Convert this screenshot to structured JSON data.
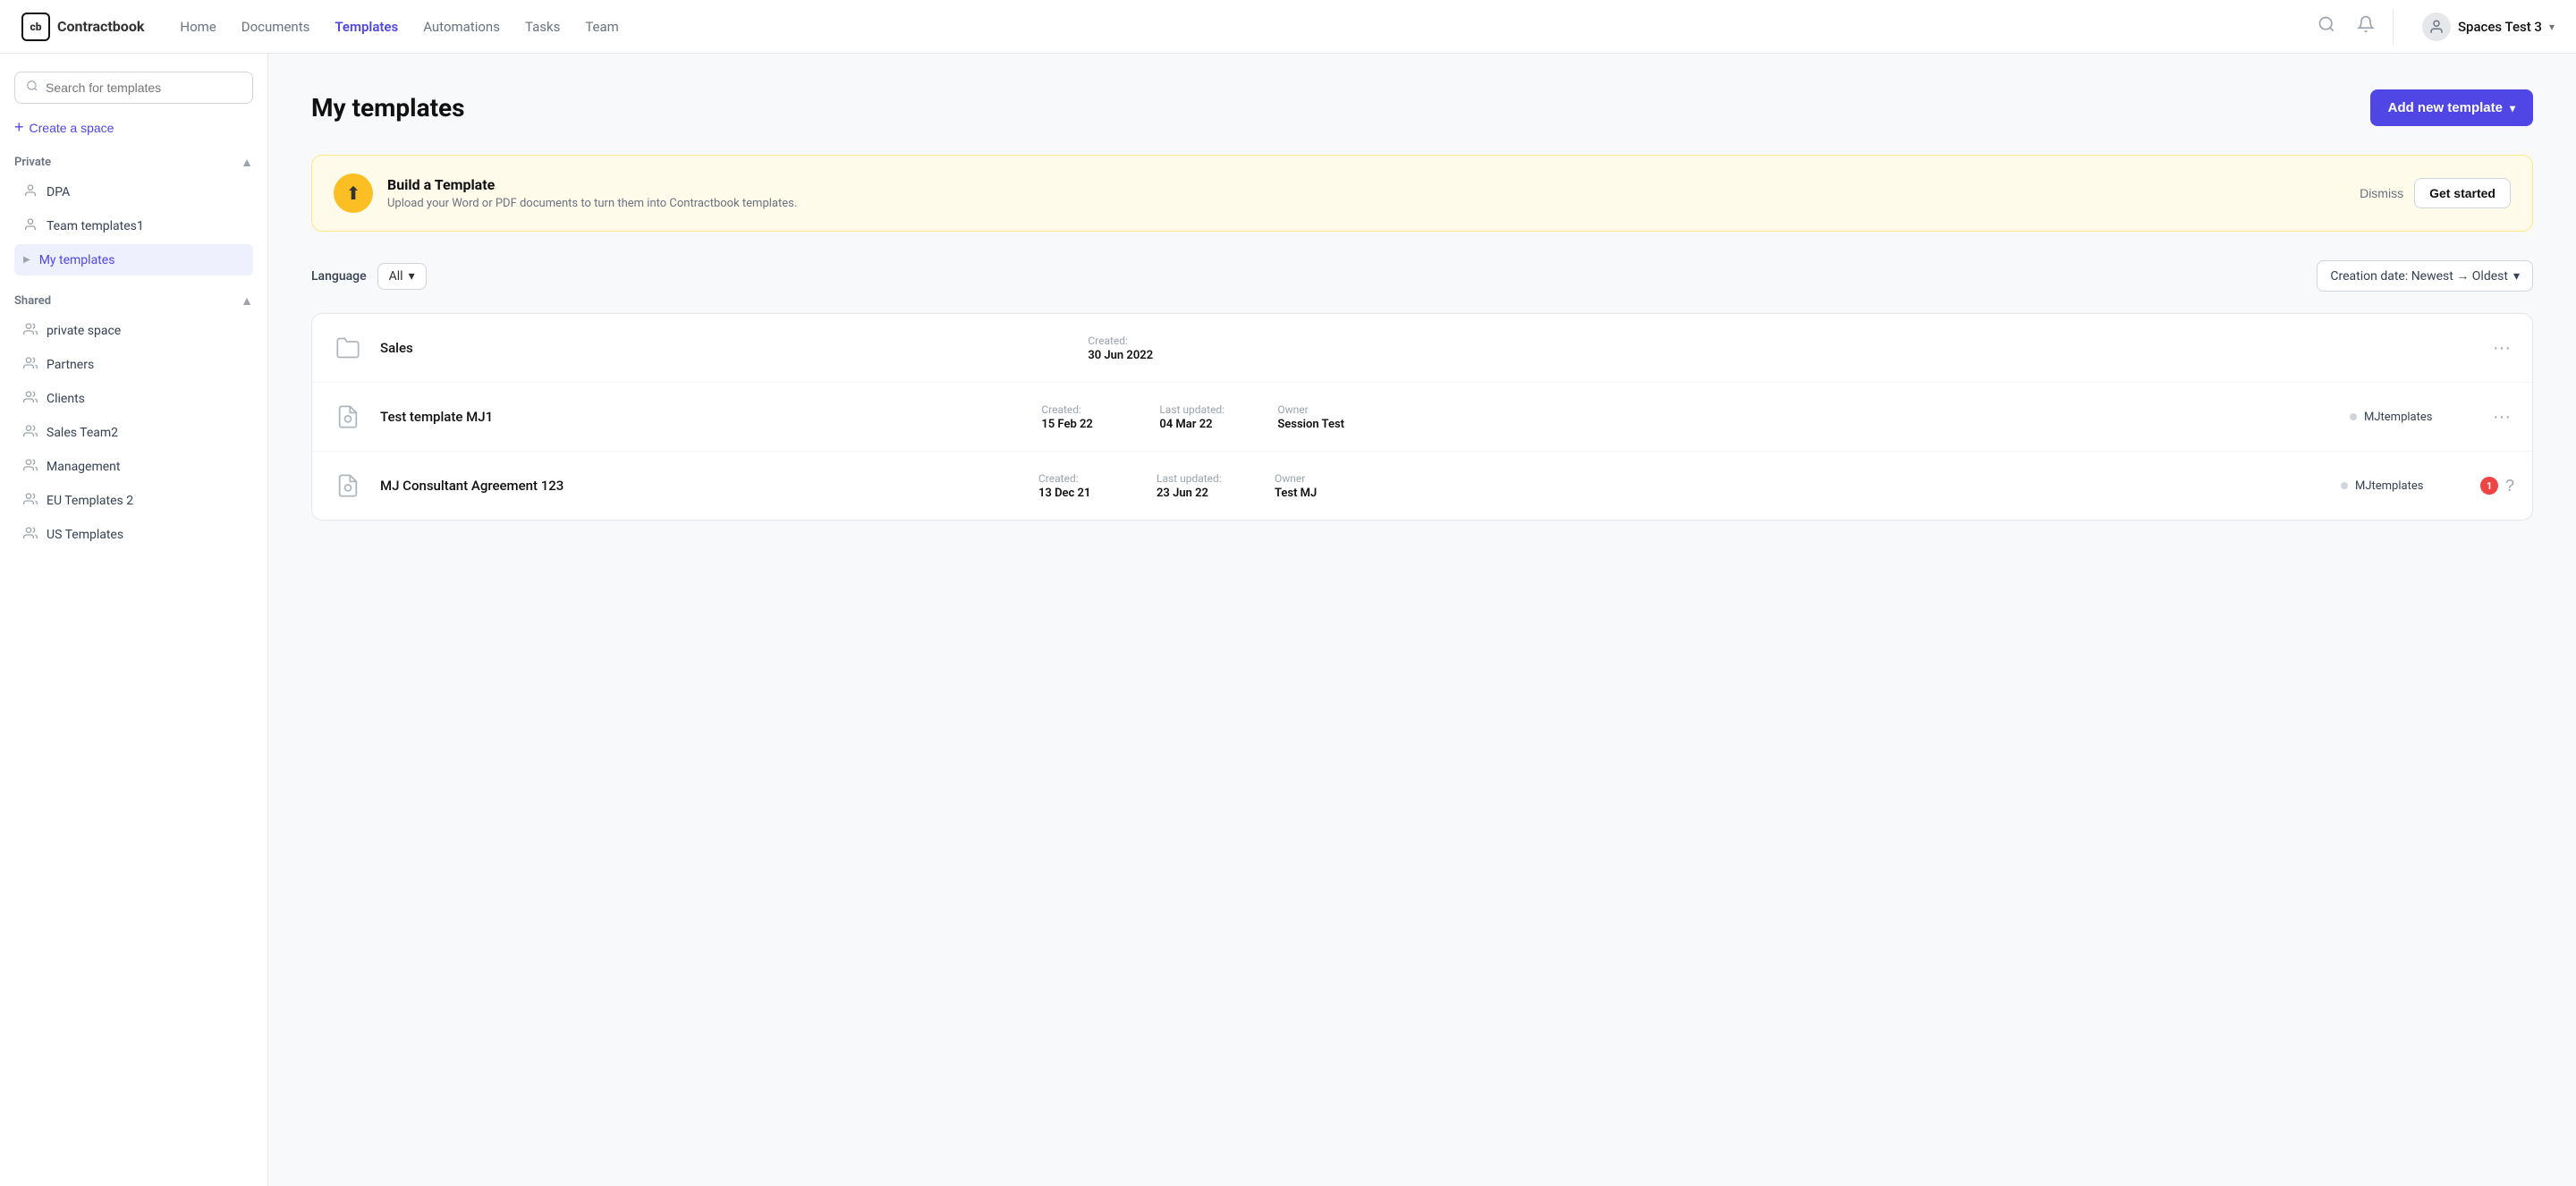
{
  "app": {
    "logo_text": "Contractbook"
  },
  "nav": {
    "links": [
      {
        "id": "home",
        "label": "Home",
        "active": false
      },
      {
        "id": "documents",
        "label": "Documents",
        "active": false
      },
      {
        "id": "templates",
        "label": "Templates",
        "active": true
      },
      {
        "id": "automations",
        "label": "Automations",
        "active": false
      },
      {
        "id": "tasks",
        "label": "Tasks",
        "active": false
      },
      {
        "id": "team",
        "label": "Team",
        "active": false
      }
    ],
    "user_name": "Spaces Test 3"
  },
  "sidebar": {
    "search_placeholder": "Search for templates",
    "create_space_label": "Create a space",
    "sections": {
      "private": {
        "label": "Private",
        "items": [
          {
            "id": "dpa",
            "label": "DPA"
          },
          {
            "id": "team-templates1",
            "label": "Team templates1"
          },
          {
            "id": "my-templates",
            "label": "My templates",
            "active": true
          }
        ]
      },
      "shared": {
        "label": "Shared",
        "items": [
          {
            "id": "private-space",
            "label": "private space"
          },
          {
            "id": "partners",
            "label": "Partners"
          },
          {
            "id": "clients",
            "label": "Clients"
          },
          {
            "id": "sales-team2",
            "label": "Sales Team2"
          },
          {
            "id": "management",
            "label": "Management"
          },
          {
            "id": "eu-templates-2",
            "label": "EU Templates 2"
          },
          {
            "id": "us-templates",
            "label": "US Templates"
          }
        ]
      }
    }
  },
  "main": {
    "page_title": "My templates",
    "add_button_label": "Add new template",
    "banner": {
      "title": "Build a Template",
      "description": "Upload your Word or PDF documents to turn them into Contractbook templates.",
      "dismiss_label": "Dismiss",
      "get_started_label": "Get started"
    },
    "filters": {
      "language_label": "Language",
      "language_value": "All",
      "sort_label": "Creation date: Newest → Oldest"
    },
    "templates": [
      {
        "id": "sales",
        "type": "folder",
        "name": "Sales",
        "created_label": "Created:",
        "created_value": "30 Jun 2022"
      },
      {
        "id": "test-template-mj1",
        "type": "template",
        "name": "Test template MJ1",
        "created_label": "Created:",
        "created_value": "15 Feb 22",
        "updated_label": "Last updated:",
        "updated_value": "04 Mar 22",
        "owner_label": "Owner",
        "owner_value": "Session Test",
        "assignee": "MJtemplates",
        "badge": null
      },
      {
        "id": "mj-consultant-agreement",
        "type": "template",
        "name": "MJ Consultant Agreement 123",
        "created_label": "Created:",
        "created_value": "13 Dec 21",
        "updated_label": "Last updated:",
        "updated_value": "23 Jun 22",
        "owner_label": "Owner",
        "owner_value": "Test MJ",
        "assignee": "MJtemplates",
        "badge": "1"
      }
    ]
  }
}
